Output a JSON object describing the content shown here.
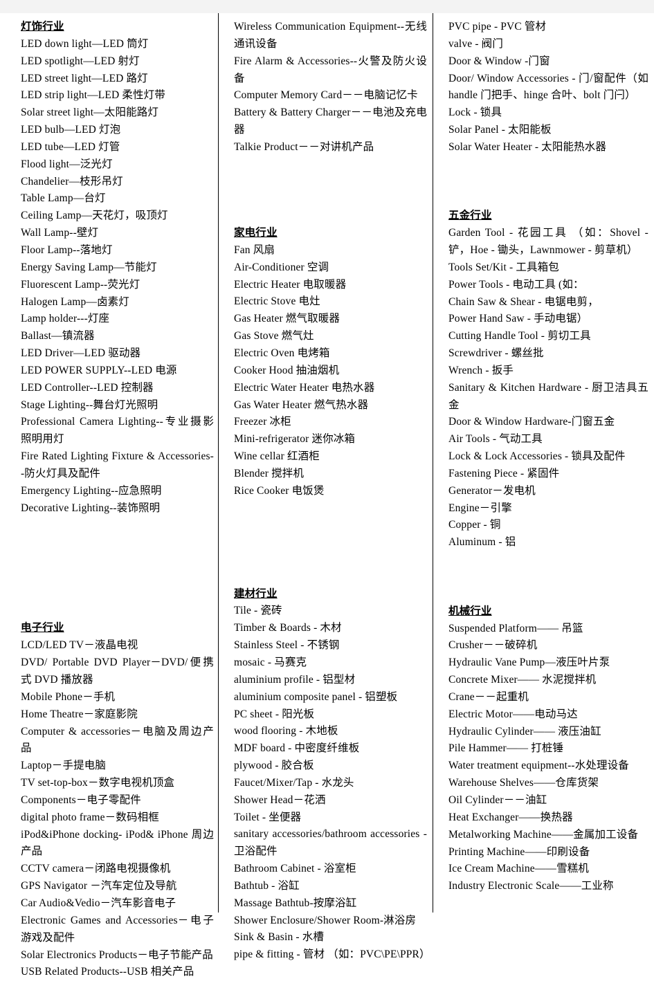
{
  "document": {
    "title": "行业产品中英文对照表",
    "page_background": "#ffffff",
    "margin_color": "#f3f3f3",
    "text_color": "#000000"
  },
  "columns": [
    {
      "id": "column-1",
      "blocks": [
        {
          "type": "section",
          "heading": "灯饰行业",
          "entries": [
            "LED down light—LED 筒灯",
            "LED spotlight—LED 射灯",
            "LED street light—LED 路灯",
            "LED strip light—LED 柔性灯带",
            "Solar street light—太阳能路灯",
            "LED bulb—LED 灯泡",
            "LED tube—LED 灯管",
            "Flood light—泛光灯",
            "Chandelier—枝形吊灯",
            "Table Lamp—台灯",
            "Ceiling Lamp—天花灯，吸顶灯",
            "Wall Lamp--壁灯",
            "Floor Lamp--落地灯",
            "Energy Saving Lamp—节能灯",
            "Fluorescent Lamp--荧光灯",
            "Halogen Lamp—卤素灯",
            "Lamp holder---灯座",
            "Ballast—镇流器",
            "LED Driver—LED 驱动器",
            "LED POWER SUPPLY--LED 电源",
            "LED Controller--LED 控制器",
            "Stage Lighting--舞台灯光照明",
            "Professional Camera Lighting--专业摄影照明用灯",
            "Fire Rated Lighting Fixture & Accessories--防火灯具及配件",
            "Emergency Lighting--应急照明",
            "Decorative Lighting--装饰照明"
          ]
        },
        {
          "type": "section",
          "heading": "电子行业",
          "entries": [
            "LCD/LED TV－液晶电视",
            "DVD/ Portable DVD Player－DVD/便携式 DVD 播放器",
            "Mobile Phone－手机",
            "Home Theatre－家庭影院",
            "Computer & accessories－电脑及周边产品",
            "Laptop－手提电脑",
            "TV set-top-box－数字电视机顶盒",
            "Components－电子零配件",
            "digital photo frame－数码相框",
            "iPod&iPhone docking- iPod& iPhone 周边产品",
            "CCTV camera－闭路电视摄像机",
            "GPS Navigator －汽车定位及导航",
            "Car Audio&Vedio－汽车影音电子",
            "Electronic Games and Accessories－电子游戏及配件",
            "Solar Electronics Products－电子节能产品",
            "USB Related Products--USB 相关产品"
          ]
        }
      ]
    },
    {
      "id": "column-2",
      "blocks": [
        {
          "type": "continuation",
          "heading": null,
          "entries": [
            "Wireless Communication Equipment--无线通讯设备",
            "Fire Alarm & Accessories--火警及防火设备",
            "Computer Memory Card－－电脑记忆卡",
            "Battery & Battery Charger－－电池及充电器",
            "Talkie Product－－对讲机产品"
          ]
        },
        {
          "type": "section",
          "heading": "家电行业",
          "entries": [
            "Fan 风扇",
            "Air-Conditioner 空调",
            "Electric Heater 电取暖器",
            "Electric Stove 电灶",
            "Gas Heater 燃气取暖器",
            "Gas Stove 燃气灶",
            "Electric Oven 电烤箱",
            "Cooker Hood 抽油烟机",
            "Electric Water Heater 电热水器",
            "Gas Water Heater 燃气热水器",
            "Freezer 冰柜",
            "Mini-refrigerator 迷你冰箱",
            "Wine cellar 红酒柜",
            "Blender 搅拌机",
            "Rice Cooker 电饭煲"
          ]
        },
        {
          "type": "section",
          "heading": "建材行业",
          "entries": [
            "Tile - 瓷砖",
            "Timber & Boards - 木材",
            "Stainless Steel - 不锈钢",
            "mosaic - 马赛克",
            "aluminium profile - 铝型材",
            "aluminium composite panel - 铝塑板",
            "PC sheet - 阳光板",
            "wood flooring - 木地板",
            "MDF board - 中密度纤维板",
            "plywood - 胶合板",
            "Faucet/Mixer/Tap - 水龙头",
            "Shower Head－花洒",
            "Toilet - 坐便器",
            "sanitary accessories/bathroom accessories - 卫浴配件",
            "Bathroom Cabinet - 浴室柜",
            "Bathtub - 浴缸",
            "Massage Bathtub-按摩浴缸",
            "Shower Enclosure/Shower Room-淋浴房",
            "Sink & Basin - 水槽",
            "pipe & fitting - 管材 （如：PVC\\PE\\PPR）"
          ]
        }
      ]
    },
    {
      "id": "column-3",
      "blocks": [
        {
          "type": "continuation",
          "heading": null,
          "entries": [
            "PVC pipe - PVC 管材",
            "valve - 阀门",
            "Door & Window -门窗",
            "Door/ Window Accessories - 门/窗配件（如 handle 门把手、hinge 合叶、bolt 门闩）",
            "Lock - 锁具",
            "Solar Panel - 太阳能板",
            "Solar Water Heater - 太阳能热水器"
          ]
        },
        {
          "type": "section",
          "heading": "五金行业",
          "entries": [
            "Garden Tool - 花园工具 （如：Shovel - 铲，Hoe - 锄头，Lawnmower - 剪草机）",
            "Tools Set/Kit - 工具箱包",
            "Power Tools - 电动工具 (如：",
            "Chain Saw & Shear - 电锯电剪，",
            "Power Hand Saw - 手动电锯）",
            "Cutting Handle Tool - 剪切工具",
            "Screwdriver - 螺丝批",
            "Wrench - 扳手",
            "Sanitary & Kitchen Hardware - 厨卫洁具五金",
            "Door & Window Hardware-门窗五金",
            "Air Tools - 气动工具",
            "Lock & Lock Accessories - 锁具及配件",
            "Fastening Piece - 紧固件",
            "Generator－发电机",
            "Engine－引擎",
            "Copper - 铜",
            "Aluminum - 铝"
          ]
        },
        {
          "type": "section",
          "heading": "机械行业",
          "entries": [
            "Suspended Platform—— 吊篮",
            "Crusher－－破碎机",
            "Hydraulic Vane Pump—液压叶片泵",
            "Concrete Mixer—— 水泥搅拌机",
            "Crane－－起重机",
            "Electric Motor——电动马达",
            "Hydraulic Cylinder—— 液压油缸",
            "Pile Hammer—— 打桩锤",
            "Water treatment equipment--水处理设备",
            "Warehouse Shelves——仓库货架",
            "Oil Cylinder－－油缸",
            "Heat Exchanger——换热器",
            "Metalworking Machine——金属加工设备",
            "Printing Machine——印刷设备",
            "Ice Cream Machine——雪糕机",
            "Industry Electronic Scale——工业称"
          ]
        }
      ]
    }
  ],
  "layout": {
    "column_1_spacer_before_section_2": "large",
    "column_2_spacer_before_section_1": "large",
    "column_2_spacer_before_section_2": "large",
    "column_3_spacer_before_section_1": "medium",
    "column_3_spacer_before_section_2": "medium"
  }
}
